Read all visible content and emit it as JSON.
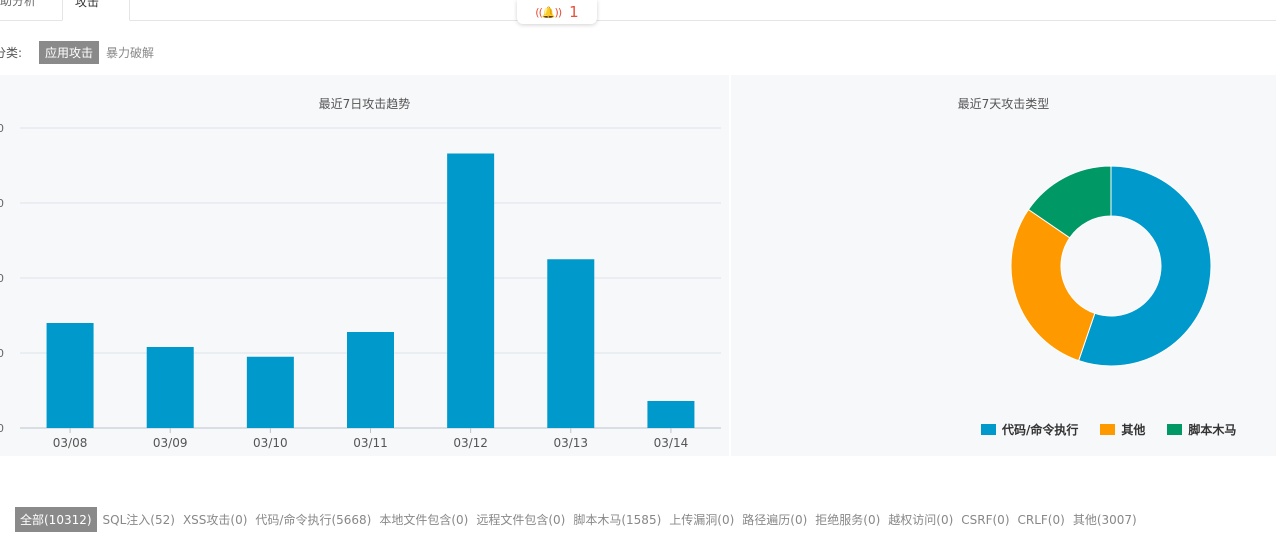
{
  "tabs": [
    {
      "label": "流量分析",
      "visible_label": "助分析"
    },
    {
      "label": "攻击"
    }
  ],
  "alert": {
    "count": "1",
    "icon": "alarm-bell-icon"
  },
  "filter": {
    "label": "分类:",
    "options": [
      "应用攻击",
      "暴力破解"
    ],
    "selected": "应用攻击"
  },
  "trend_panel": {
    "title": "最近7日攻击趋势"
  },
  "types_panel": {
    "title": "最近7天攻击类型"
  },
  "chart_data": [
    {
      "type": "bar",
      "title": "最近7日攻击趋势",
      "categories": [
        "03/08",
        "03/09",
        "03/10",
        "03/11",
        "03/12",
        "03/13",
        "03/14"
      ],
      "values": [
        700,
        540,
        475,
        640,
        1830,
        1125,
        180
      ],
      "ylim": [
        0,
        2000
      ],
      "y_tick_labels": [
        "0",
        "0",
        "0",
        "0",
        "0"
      ],
      "color": "#0099cc",
      "grid": true
    },
    {
      "type": "pie",
      "title": "最近7天攻击类型",
      "donut": true,
      "labels": [
        "代码/命令执行",
        "其他",
        "脚本木马"
      ],
      "values": [
        5668,
        3007,
        1585
      ],
      "colors": [
        "#0099cc",
        "#ff9900",
        "#009966"
      ],
      "legend": "bottom"
    }
  ],
  "legend": [
    {
      "label": "代码/命令执行",
      "color": "#0099cc"
    },
    {
      "label": "其他",
      "color": "#ff9900"
    },
    {
      "label": "脚本木马",
      "color": "#009966"
    }
  ],
  "categories": [
    {
      "label": "全部(10312)",
      "active": true
    },
    {
      "label": "SQL注入(52)"
    },
    {
      "label": "XSS攻击(0)"
    },
    {
      "label": "代码/命令执行(5668)"
    },
    {
      "label": "本地文件包含(0)"
    },
    {
      "label": "远程文件包含(0)"
    },
    {
      "label": "脚本木马(1585)"
    },
    {
      "label": "上传漏洞(0)"
    },
    {
      "label": "路径遍历(0)"
    },
    {
      "label": "拒绝服务(0)"
    },
    {
      "label": "越权访问(0)"
    },
    {
      "label": "CSRF(0)"
    },
    {
      "label": "CRLF(0)"
    },
    {
      "label": "其他(3007)"
    }
  ]
}
